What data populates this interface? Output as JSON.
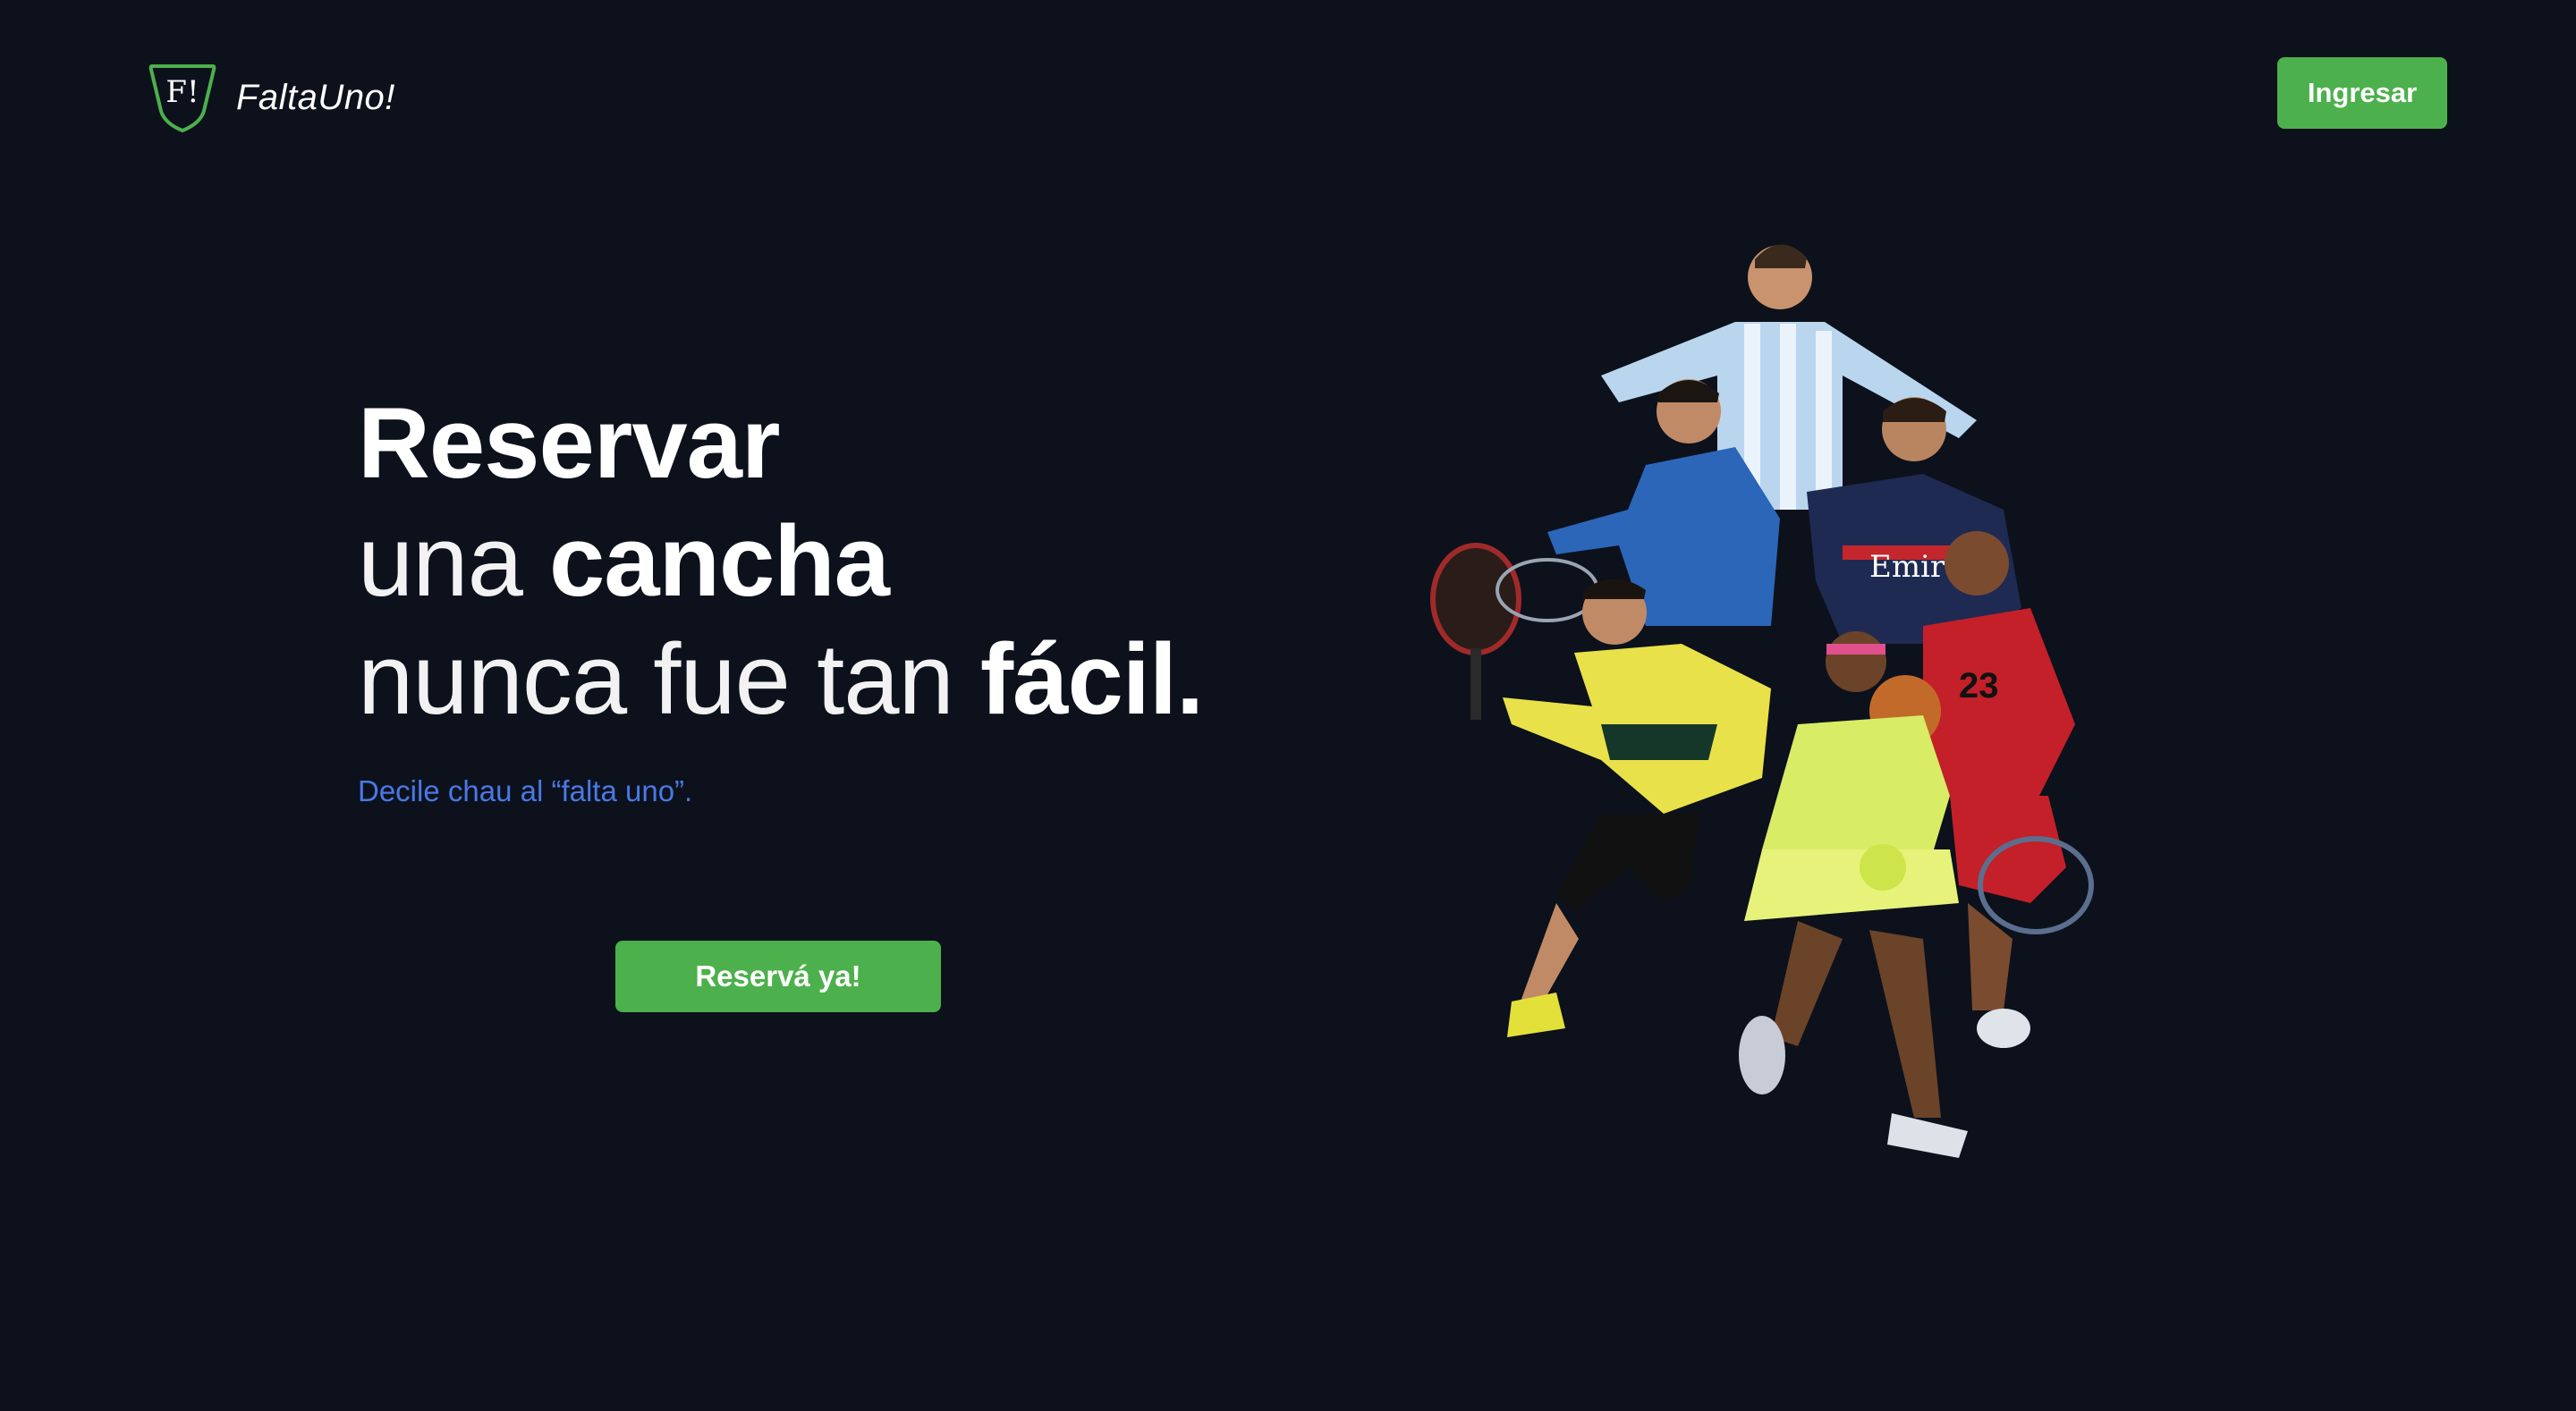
{
  "header": {
    "brand_mark": "F!",
    "brand_name": "FaltaUno!",
    "login_label": "Ingresar"
  },
  "hero": {
    "line1_bold": "Reservar",
    "line2_thin": "una ",
    "line2_bold": "cancha",
    "line3_thin": "nunca fue tan ",
    "line3_bold": "fácil.",
    "tagline": "Decile chau al “falta uno”.",
    "cta_label": "Reservá ya!"
  },
  "colors": {
    "background": "#0c111c",
    "accent": "#4cb04c",
    "tagline": "#4a78e6"
  },
  "icons": {
    "logo": "shield-logo-icon"
  }
}
